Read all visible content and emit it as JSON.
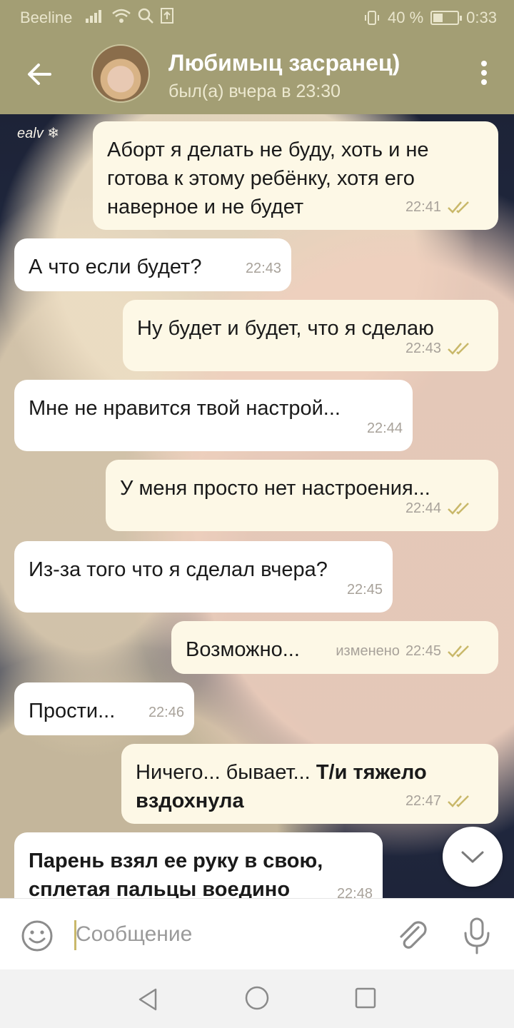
{
  "status_bar": {
    "carrier": "Beeline",
    "battery_text": "40 %",
    "battery_level": 0.4,
    "time": "0:33"
  },
  "header": {
    "title": "Любимыц засранец)",
    "subtitle": "был(а) вчера в 23:30"
  },
  "messages": [
    {
      "dir": "out",
      "text": "Аборт я делать не буду, хоть и не готова к этому ребёнку, хотя его наверное и не будет",
      "time": "22:41",
      "read": true
    },
    {
      "dir": "in",
      "text": "А что если будет?",
      "time": "22:43"
    },
    {
      "dir": "out",
      "text": "Ну будет и будет, что я сделаю",
      "time": "22:43",
      "read": true
    },
    {
      "dir": "in",
      "text": "Мне не нравится твой настрой...",
      "time": "22:44"
    },
    {
      "dir": "out",
      "text": "У меня просто нет настроения...",
      "time": "22:44",
      "read": true
    },
    {
      "dir": "in",
      "text": "Из-за того что я сделал вчера?",
      "time": "22:45"
    },
    {
      "dir": "out",
      "text": "Возможно...",
      "edited_label": "изменено",
      "time": "22:45",
      "read": true
    },
    {
      "dir": "in",
      "text": "Прости...",
      "time": "22:46"
    },
    {
      "dir": "out",
      "text": "Ничего... бывает...",
      "bold_text": "Т/и тяжело вздохнула",
      "time": "22:47",
      "read": true
    },
    {
      "dir": "in",
      "bold_text": "Парень взял ее руку в свою, сплетая пальцы воедино",
      "time": "22:48"
    }
  ],
  "composer": {
    "placeholder": "Сообщение"
  },
  "icons": {
    "back": "arrow-left-icon",
    "menu": "more-vert-icon",
    "emoji": "emoji-icon",
    "attach": "paperclip-icon",
    "mic": "mic-icon",
    "scroll_down": "chevron-down-icon"
  },
  "colors": {
    "header": "#a39e74",
    "outgoing_bubble": "#fdf8e6",
    "incoming_bubble": "#ffffff",
    "read_check": "#c9b86a"
  }
}
